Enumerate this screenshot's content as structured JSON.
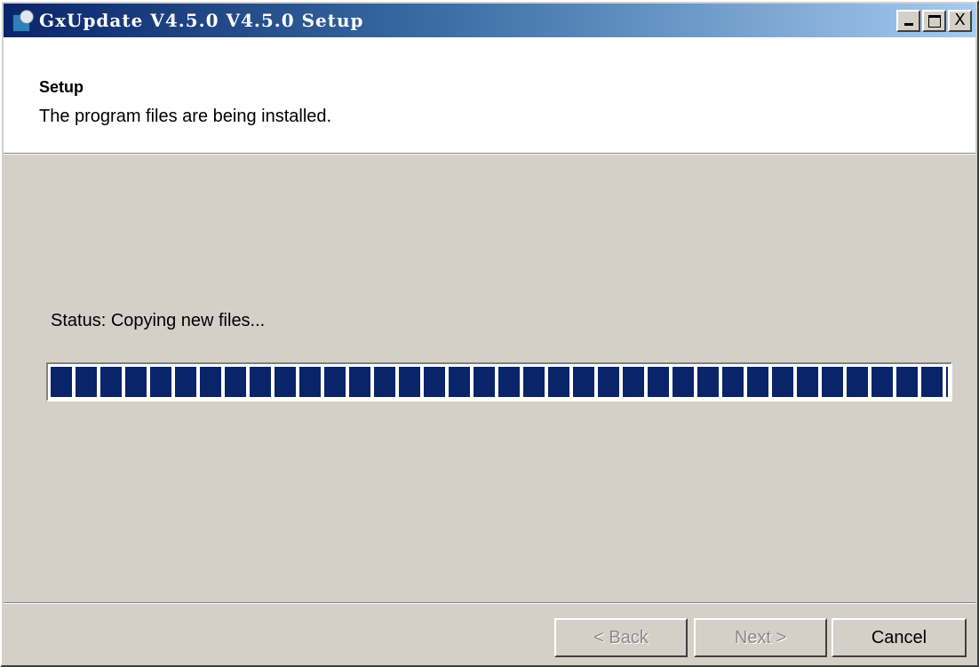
{
  "window": {
    "title": "GxUpdate V4.5.0 V4.5.0 Setup",
    "icon": "installer-app-icon",
    "controls": {
      "minimize_icon": "minimize-icon",
      "maximize_icon": "maximize-icon",
      "close_label": "X"
    }
  },
  "header": {
    "title": "Setup",
    "description": "The program files are being installed."
  },
  "body": {
    "status_text": "Status: Copying new files...",
    "progress": 1.0
  },
  "buttons": {
    "back": "< Back",
    "next": "Next >",
    "cancel": "Cancel"
  },
  "colors": {
    "titlebar_start": "#0a246a",
    "titlebar_end": "#a6caf0",
    "progress_fill": "#0a246a",
    "dialog_face": "#d4d0c8"
  }
}
